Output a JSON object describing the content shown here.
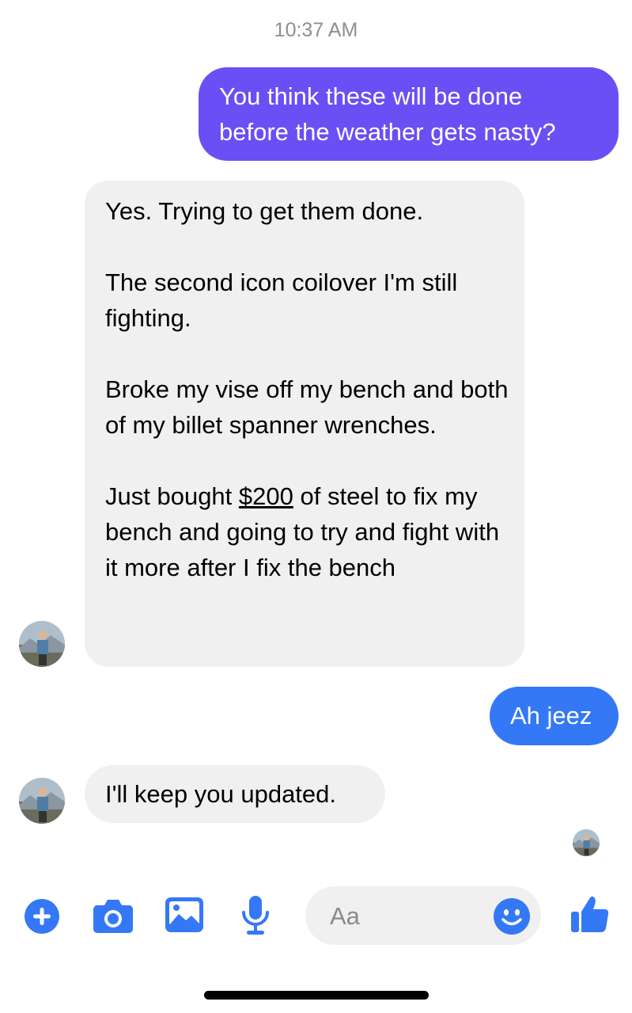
{
  "timestamp": "10:37 AM",
  "messages": [
    {
      "direction": "outgoing",
      "lines": [
        "You think these will be done",
        "before the weather gets nasty?"
      ]
    },
    {
      "direction": "incoming",
      "paragraphs": [
        "Yes. Trying to get them done.",
        "The second icon coilover I'm still fighting.",
        "Broke my vise off my bench and both of my billet spanner wrenches.",
        {
          "before": "Just bought ",
          "link": "$200",
          "after": " of steel to fix my bench and going to try and fight with it more after I fix the bench"
        }
      ]
    },
    {
      "direction": "outgoing",
      "text": "Ah jeez"
    },
    {
      "direction": "incoming",
      "text": "I'll keep you updated."
    }
  ],
  "composer": {
    "placeholder": "Aa",
    "icons": [
      "plus-icon",
      "camera-icon",
      "image-icon",
      "microphone-icon",
      "emoji-icon",
      "thumbs-up-icon"
    ]
  },
  "colors": {
    "outgoing_purple": "#6a4ff5",
    "outgoing_blue": "#3478f6",
    "incoming_bg": "#f0f0f0",
    "accent": "#3478f6"
  }
}
